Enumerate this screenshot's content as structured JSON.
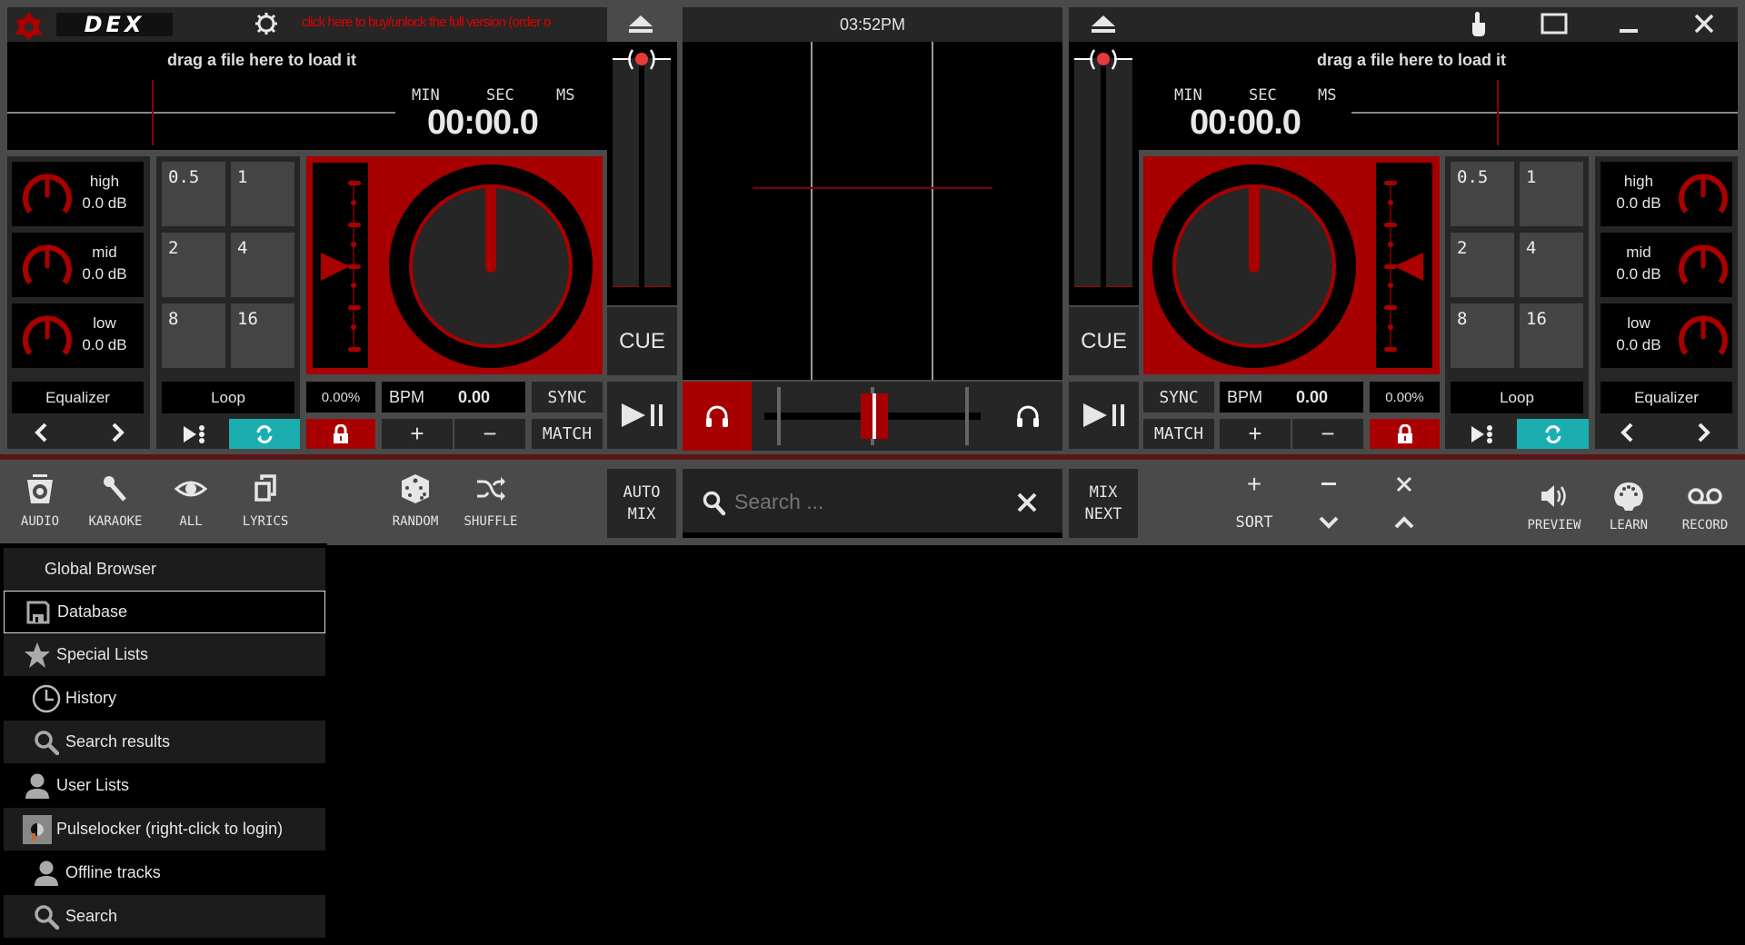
{
  "header": {
    "app_name": "DEX",
    "buy_notice": "click here to buy/unlock the full version (order o",
    "clock": "03:52PM"
  },
  "deck_left": {
    "drop_hint": "drag a file here to load it",
    "time_labels": {
      "min": "MIN",
      "sec": "SEC",
      "ms": "MS"
    },
    "time": "00:00.0",
    "eq": [
      {
        "band": "high",
        "value": "0.0 dB"
      },
      {
        "band": "mid",
        "value": "0.0 dB"
      },
      {
        "band": "low",
        "value": "0.0 dB"
      }
    ],
    "eq_title": "Equalizer",
    "loop_pads": [
      "0.5",
      "1",
      "2",
      "4",
      "8",
      "16"
    ],
    "loop_title": "Loop",
    "pitch": "0.00%",
    "bpm_label": "BPM",
    "bpm": "0.00",
    "sync": "SYNC",
    "match": "MATCH",
    "cue": "CUE",
    "plus": "+",
    "minus": "−"
  },
  "deck_right": {
    "drop_hint": "drag a file here to load it",
    "time_labels": {
      "min": "MIN",
      "sec": "SEC",
      "ms": "MS"
    },
    "time": "00:00.0",
    "eq": [
      {
        "band": "high",
        "value": "0.0 dB"
      },
      {
        "band": "mid",
        "value": "0.0 dB"
      },
      {
        "band": "low",
        "value": "0.0 dB"
      }
    ],
    "eq_title": "Equalizer",
    "loop_pads": [
      "0.5",
      "1",
      "2",
      "4",
      "8",
      "16"
    ],
    "loop_title": "Loop",
    "pitch": "0.00%",
    "bpm_label": "BPM",
    "bpm": "0.00",
    "sync": "SYNC",
    "match": "MATCH",
    "cue": "CUE",
    "plus": "+",
    "minus": "−"
  },
  "mixer": {
    "crossfader_position": 0.5,
    "left_headphone_active": true,
    "right_headphone_active": false
  },
  "toolbar": {
    "left": [
      {
        "icon": "speaker-box-icon",
        "label": "AUDIO"
      },
      {
        "icon": "microphone-icon",
        "label": "KARAOKE"
      },
      {
        "icon": "eye-icon",
        "label": "ALL"
      },
      {
        "icon": "copy-icon",
        "label": "LYRICS"
      },
      {
        "icon": "dice-icon",
        "label": "RANDOM"
      },
      {
        "icon": "shuffle-icon",
        "label": "SHUFFLE"
      }
    ],
    "automix": "AUTO\nMIX",
    "automix_l1": "AUTO",
    "automix_l2": "MIX",
    "search_placeholder": "Search ...",
    "mixnext_l1": "MIX",
    "mixnext_l2": "NEXT",
    "sort": "SORT",
    "right": [
      {
        "icon": "speaker-icon",
        "label": "PREVIEW"
      },
      {
        "icon": "midi-icon",
        "label": "LEARN"
      },
      {
        "icon": "voicemail-icon",
        "label": "RECORD"
      }
    ]
  },
  "sidebar": {
    "items": [
      {
        "label": "Global Browser",
        "icon": ""
      },
      {
        "label": "Database",
        "icon": "floppy-icon",
        "selected": true
      },
      {
        "label": "Special Lists",
        "icon": "star-icon"
      },
      {
        "label": "History",
        "icon": "clock-icon"
      },
      {
        "label": "Search results",
        "icon": "search-icon"
      },
      {
        "label": "User Lists",
        "icon": "user-icon"
      },
      {
        "label": "Pulselocker (right-click to login)",
        "icon": "pulselocker-icon"
      },
      {
        "label": "Offline tracks",
        "icon": "user-icon"
      },
      {
        "label": "Search",
        "icon": "search-icon"
      }
    ]
  },
  "colors": {
    "accent_red": "#a80000",
    "teal": "#1aaeb0",
    "frame": "#4a4a4a",
    "panel": "#262626"
  }
}
